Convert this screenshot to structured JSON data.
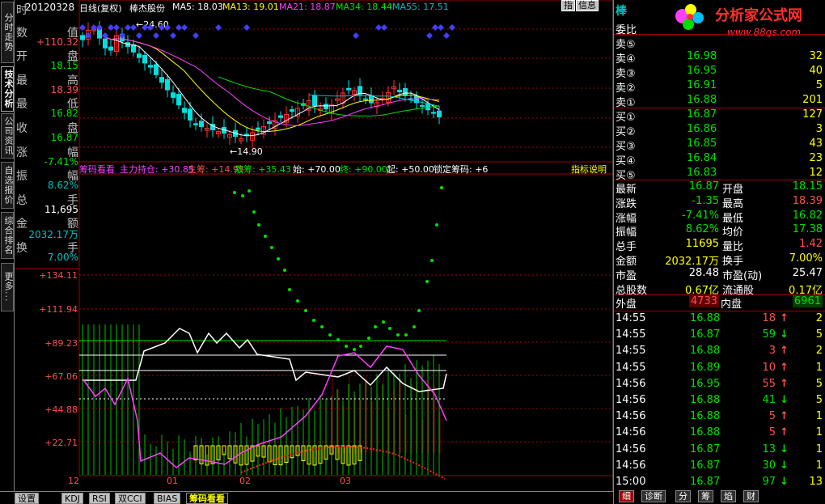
{
  "left_tabs": [
    "分时走势",
    "技术分析",
    "公司资讯",
    "自选报价",
    "综合排名",
    "更多..."
  ],
  "left_tab_active": 1,
  "left_info": [
    {
      "k": "时",
      "k2": "间",
      "v": "20120328",
      "c": "white"
    },
    {
      "k": "数",
      "k2": "值",
      "v": "+110.32",
      "c": "red"
    },
    {
      "k": "开",
      "k2": "盘",
      "v": "18.15",
      "c": "green"
    },
    {
      "k": "最",
      "k2": "高",
      "v": "18.39",
      "c": "red"
    },
    {
      "k": "最",
      "k2": "低",
      "v": "16.82",
      "c": "green"
    },
    {
      "k": "收",
      "k2": "盘",
      "v": "16.87",
      "c": "green"
    },
    {
      "k": "涨",
      "k2": "幅",
      "v": "-7.41%",
      "c": "green"
    },
    {
      "k": "振",
      "k2": "幅",
      "v": "8.62%",
      "c": "cyan"
    },
    {
      "k": "总",
      "k2": "手",
      "v": "11,695",
      "c": "white"
    },
    {
      "k": "金",
      "k2": "额",
      "v": "2032.17万",
      "c": "cyan"
    },
    {
      "k": "换",
      "k2": "手",
      "v": "7.00%",
      "c": "cyan"
    }
  ],
  "header": {
    "period": "日线(复权)",
    "stock": "棒杰股份",
    "ma": [
      {
        "label": "MA5: 18.03",
        "color": "#ffffff"
      },
      {
        "label": "MA13: 19.01",
        "color": "#ffff00"
      },
      {
        "label": "MA21: 18.87",
        "color": "#ff40ff"
      },
      {
        "label": "MA34: 18.44",
        "color": "#00e000"
      },
      {
        "label": "MA55: 17.51",
        "color": "#00c0c0"
      }
    ],
    "btn_zhi": "指",
    "btn_info": "信息"
  },
  "price_annotations": {
    "high": "24.60",
    "low": "14.90"
  },
  "indicator": {
    "name": "筹码看看",
    "items": [
      {
        "t": "主力持仓: +30.85",
        "c": "#ff40ff"
      },
      {
        "t": "主筹: +14.95",
        "c": "#ff5050"
      },
      {
        "t": "散筹: +35.43",
        "c": "#00e000"
      },
      {
        "t": "始: +70.00",
        "c": "#ffffff"
      },
      {
        "t": "终: +90.00",
        "c": "#00e000"
      },
      {
        "t": "起: +50.00",
        "c": "#ffffff"
      },
      {
        "t": "锁定筹码: +6",
        "c": "#ffffff"
      }
    ],
    "help": "指标说明"
  },
  "y_axis_labels": [
    "+134.11",
    "+111.94",
    "+89.23",
    "+67.06",
    "+44.88",
    "+22.71"
  ],
  "x_axis_labels": [
    "12",
    "01",
    "02",
    "03"
  ],
  "bottom_tabs": [
    "设置",
    "KDJ",
    "RSI",
    "双CCI",
    "BIAS",
    "筹码看看"
  ],
  "bottom_tab_active": 5,
  "right": {
    "logo_text": "分析家公式网",
    "logo_url": "www.88gs.com",
    "weibi": "委比",
    "sell": [
      {
        "l": "卖⑤",
        "p": "",
        "v": ""
      },
      {
        "l": "卖④",
        "p": "16.98",
        "v": "32"
      },
      {
        "l": "卖③",
        "p": "16.95",
        "v": "40"
      },
      {
        "l": "卖②",
        "p": "16.91",
        "v": "5"
      },
      {
        "l": "卖①",
        "p": "16.88",
        "v": "201"
      }
    ],
    "buy": [
      {
        "l": "买①",
        "p": "16.87",
        "v": "127"
      },
      {
        "l": "买②",
        "p": "16.86",
        "v": "3"
      },
      {
        "l": "买③",
        "p": "16.85",
        "v": "43"
      },
      {
        "l": "买④",
        "p": "16.84",
        "v": "23"
      },
      {
        "l": "买⑤",
        "p": "16.83",
        "v": "12"
      }
    ],
    "stats": [
      {
        "a": "最新",
        "av": "16.87",
        "ac": "green",
        "b": "开盘",
        "bv": "18.15",
        "bc": "green"
      },
      {
        "a": "涨跌",
        "av": "-1.35",
        "ac": "green",
        "b": "最高",
        "bv": "18.39",
        "bc": "red"
      },
      {
        "a": "涨幅",
        "av": "-7.41%",
        "ac": "green",
        "b": "最低",
        "bv": "16.82",
        "bc": "green"
      },
      {
        "a": "振幅",
        "av": "8.62%",
        "ac": "green",
        "b": "均价",
        "bv": "17.38",
        "bc": "green"
      },
      {
        "a": "总手",
        "av": "11695",
        "ac": "yellow",
        "b": "量比",
        "bv": "1.42",
        "bc": "red"
      },
      {
        "a": "金额",
        "av": "2032.17万",
        "ac": "yellow",
        "b": "换手",
        "bv": "7.00%",
        "bc": "yellow"
      },
      {
        "a": "市盈",
        "av": "28.48",
        "ac": "white",
        "b": "市盈(动)",
        "bv": "25.47",
        "bc": "white"
      },
      {
        "a": "总股数",
        "av": "0.67亿",
        "ac": "yellow",
        "b": "流通股",
        "bv": "0.17亿",
        "bc": "yellow"
      }
    ],
    "outer": {
      "l": "外盘",
      "v": "4733",
      "l2": "内盘",
      "v2": "6961"
    },
    "ticks": [
      {
        "t": "14:55",
        "p": "16.88",
        "v": "18",
        "d": "up",
        "n": "2"
      },
      {
        "t": "14:55",
        "p": "16.87",
        "v": "59",
        "d": "down",
        "n": "5"
      },
      {
        "t": "14:55",
        "p": "16.88",
        "v": "3",
        "d": "up",
        "n": "2"
      },
      {
        "t": "14:55",
        "p": "16.89",
        "v": "10",
        "d": "up",
        "n": "1"
      },
      {
        "t": "14:56",
        "p": "16.95",
        "v": "55",
        "d": "up",
        "n": "5"
      },
      {
        "t": "14:56",
        "p": "16.88",
        "v": "41",
        "d": "down",
        "n": "5"
      },
      {
        "t": "14:56",
        "p": "16.88",
        "v": "5",
        "d": "up",
        "n": "1"
      },
      {
        "t": "14:56",
        "p": "16.88",
        "v": "5",
        "d": "up",
        "n": "1"
      },
      {
        "t": "14:56",
        "p": "16.87",
        "v": "13",
        "d": "down",
        "n": "1"
      },
      {
        "t": "14:56",
        "p": "16.87",
        "v": "30",
        "d": "down",
        "n": "1"
      },
      {
        "t": "15:00",
        "p": "16.87",
        "v": "97",
        "d": "down",
        "n": "13"
      }
    ],
    "tabs": [
      "细",
      "诊断",
      "分",
      "筹",
      "焰",
      "财"
    ],
    "tab_active": 0
  },
  "colors": {
    "grid": "#a00000",
    "up": "#ff3030",
    "down": "#00e0e0",
    "bg": "#000000"
  }
}
